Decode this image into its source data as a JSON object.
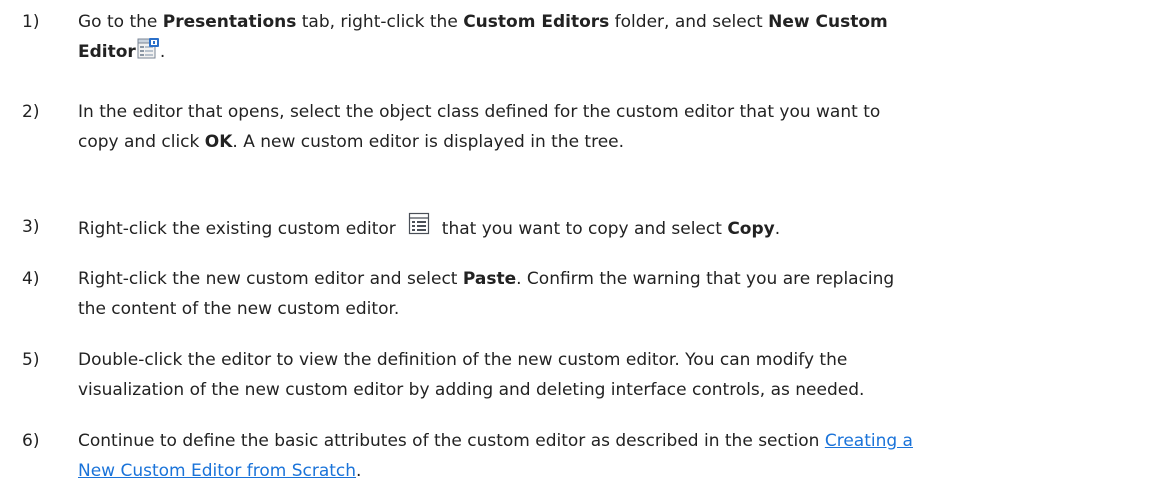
{
  "steps": [
    {
      "num": "1)",
      "t1": "Go to the ",
      "b1": "Presentations",
      "t2": " tab, right-click the ",
      "b2": "Custom Editors",
      "t3": " folder, and select ",
      "b3": "New Custom",
      "b4": "Editor",
      "t4": ".",
      "icon": "new-custom-editor-icon"
    },
    {
      "num": "2)",
      "l1": "In the editor that opens, select the object class defined for the custom editor that you want to",
      "t1": "copy and click ",
      "b1": "OK",
      "t2": ". A new custom editor is displayed in the tree."
    },
    {
      "num": "3)",
      "t1": "Right-click the existing custom editor",
      "t2": "that you want to copy and select ",
      "b1": "Copy",
      "t3": ".",
      "icon": "custom-editor-icon"
    },
    {
      "num": "4)",
      "t1": "Right-click the new custom editor and select ",
      "b1": "Paste",
      "t2": ". Confirm the warning that you are replacing",
      "l2": "the content of the new custom editor."
    },
    {
      "num": "5)",
      "l1": "Double-click the editor to view the definition of the new custom editor. You can modify the",
      "l2": "visualization of the new custom editor by adding and deleting interface controls, as needed."
    },
    {
      "num": "6)",
      "t1": "Continue to define the basic attributes of the custom editor as described in the section ",
      "link1": "Creating a",
      "link2": "New Custom Editor from Scratch",
      "t2": "."
    }
  ],
  "colors": {
    "text": "#222222",
    "link": "#1a73d9",
    "icon_blue": "#2a6fc9"
  }
}
